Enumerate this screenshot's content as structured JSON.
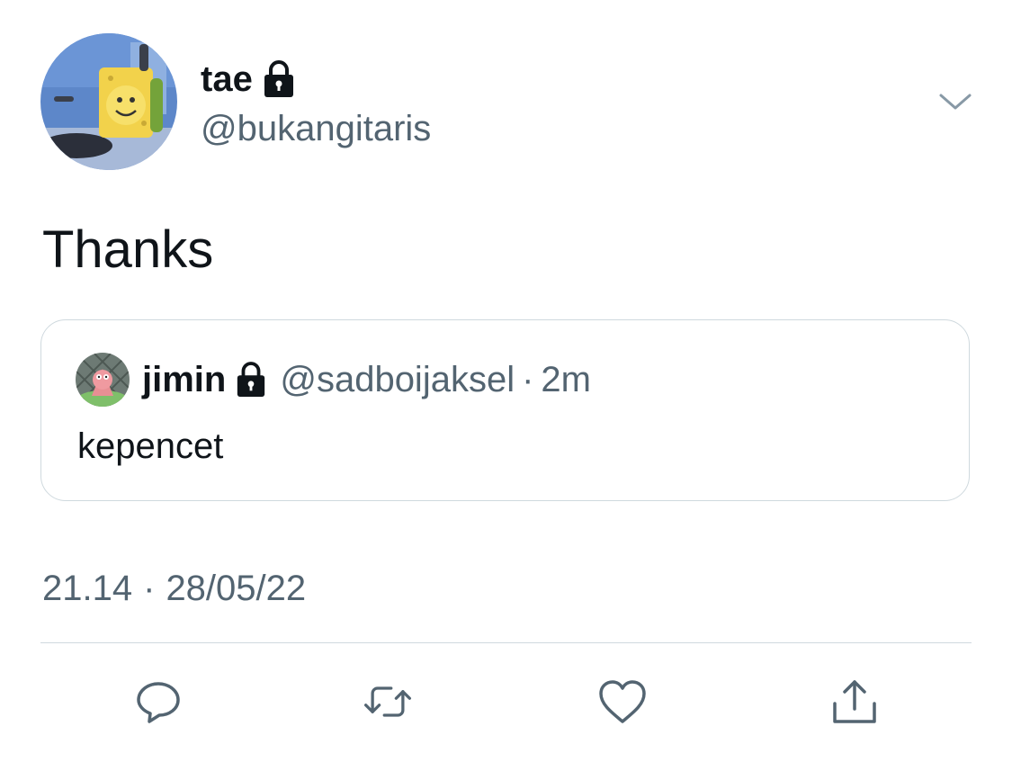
{
  "author": {
    "display_name": "tae",
    "handle": "@bukangitaris",
    "protected": true
  },
  "tweet": {
    "text": "Thanks",
    "time": "21.14",
    "separator": "·",
    "date": "28/05/22"
  },
  "quoted": {
    "display_name": "jimin",
    "handle": "@sadboijaksel",
    "separator": "·",
    "time": "2m",
    "text": "kepencet",
    "protected": true
  },
  "actions": [
    {
      "icon": "reply-icon"
    },
    {
      "icon": "retweet-icon"
    },
    {
      "icon": "like-icon"
    },
    {
      "icon": "share-icon"
    }
  ],
  "colors": {
    "text_primary": "#0f1419",
    "text_secondary": "#536471",
    "border": "#cfd9de"
  }
}
